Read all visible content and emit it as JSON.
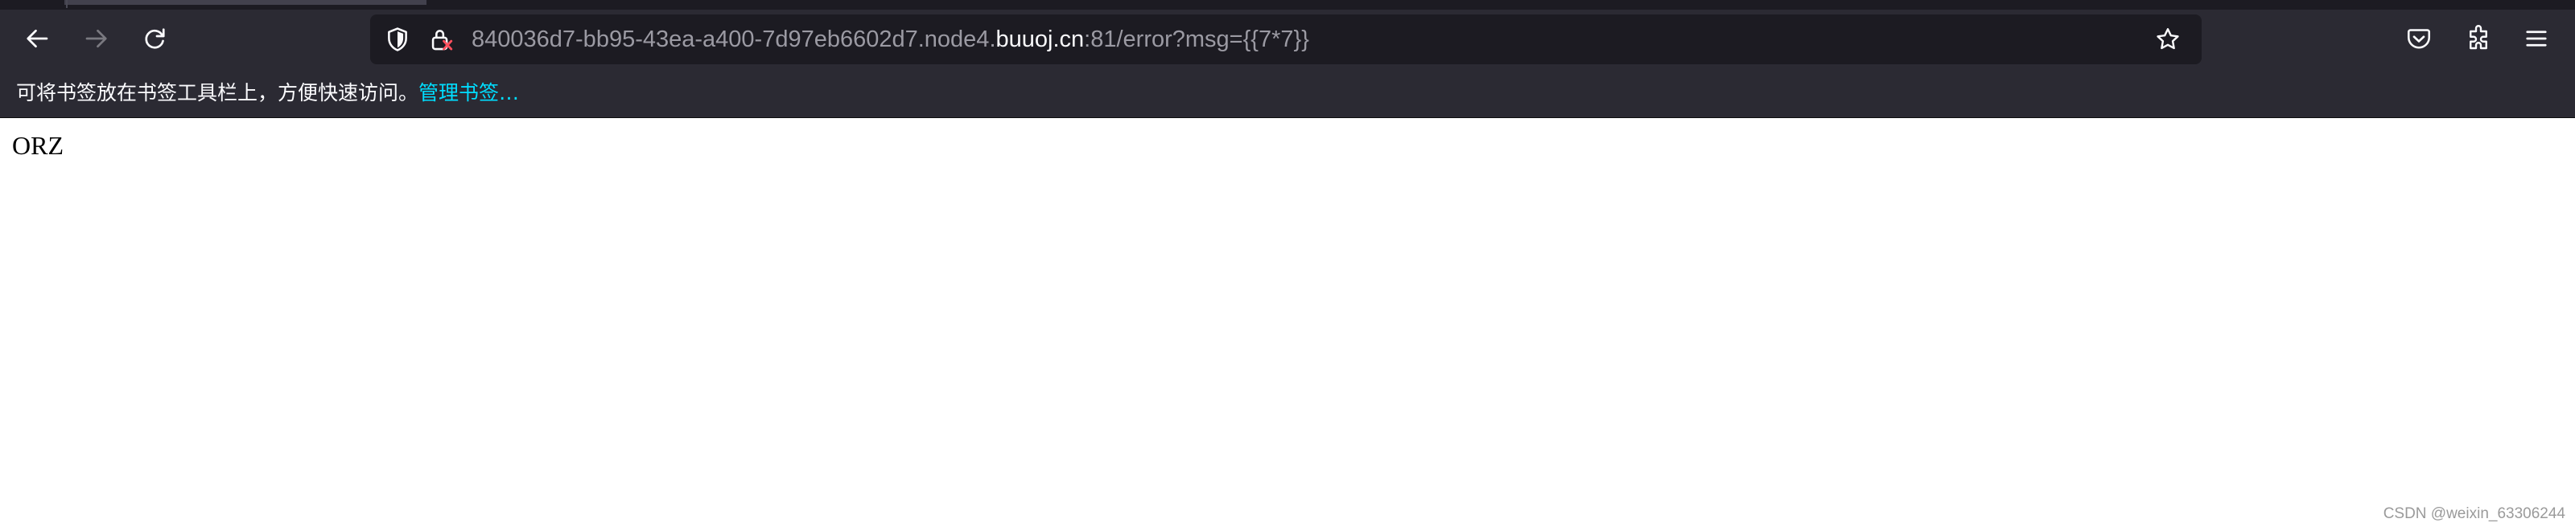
{
  "browser": {
    "url_prefix": "840036d7-bb95-43ea-a400-7d97eb6602d7.node4.",
    "url_host": "buuoj.cn",
    "url_suffix": ":81/error?msg={{7*7}}",
    "toolbar_icons": {
      "back": "back-arrow-icon",
      "forward": "forward-arrow-icon",
      "reload": "reload-icon",
      "tracking_protection": "shield-icon",
      "connection": "insecure-lock-icon",
      "bookmark": "star-icon",
      "pocket": "pocket-icon",
      "extensions": "puzzle-icon",
      "menu": "hamburger-menu-icon"
    }
  },
  "bookmarks_bar": {
    "hint": "可将书签放在书签工具栏上，方便快速访问。",
    "manage_link": "管理书签…"
  },
  "page": {
    "body_text": "ORZ"
  },
  "watermark": "CSDN @weixin_63306244",
  "colors": {
    "chrome_bg": "#2b2a33",
    "urlbar_bg": "#1c1b22",
    "link_accent": "#00ddff"
  }
}
